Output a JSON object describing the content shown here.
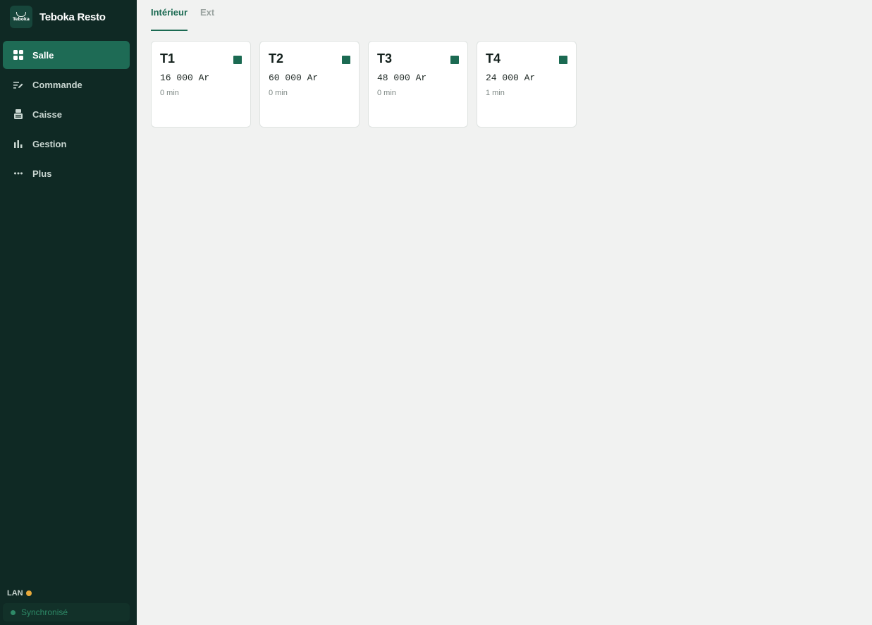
{
  "app": {
    "name": "Teboka Resto",
    "logo_text": "Teboka"
  },
  "sidebar": {
    "items": [
      {
        "label": "Salle",
        "icon": "grid-icon",
        "active": true
      },
      {
        "label": "Commande",
        "icon": "edit-list-icon",
        "active": false
      },
      {
        "label": "Caisse",
        "icon": "register-icon",
        "active": false
      },
      {
        "label": "Gestion",
        "icon": "bar-chart-icon",
        "active": false
      },
      {
        "label": "Plus",
        "icon": "more-icon",
        "active": false
      }
    ],
    "network_label": "LAN",
    "network_status_color": "#e8a93b",
    "sync_label": "Synchronisé",
    "sync_status_color": "#2e8a67"
  },
  "tabs": [
    {
      "label": "Intérieur",
      "active": true
    },
    {
      "label": "Ext",
      "active": false
    }
  ],
  "tables": [
    {
      "name": "T1",
      "amount": "16 000 Ar",
      "time": "0 min",
      "status_color": "#1b6a52"
    },
    {
      "name": "T2",
      "amount": "60 000 Ar",
      "time": "0 min",
      "status_color": "#1b6a52"
    },
    {
      "name": "T3",
      "amount": "48 000 Ar",
      "time": "0 min",
      "status_color": "#1b6a52"
    },
    {
      "name": "T4",
      "amount": "24 000 Ar",
      "time": "1 min",
      "status_color": "#1b6a52"
    }
  ],
  "colors": {
    "sidebar_bg": "#0f2924",
    "accent": "#1e6b55",
    "page_bg": "#f1f2f1"
  }
}
